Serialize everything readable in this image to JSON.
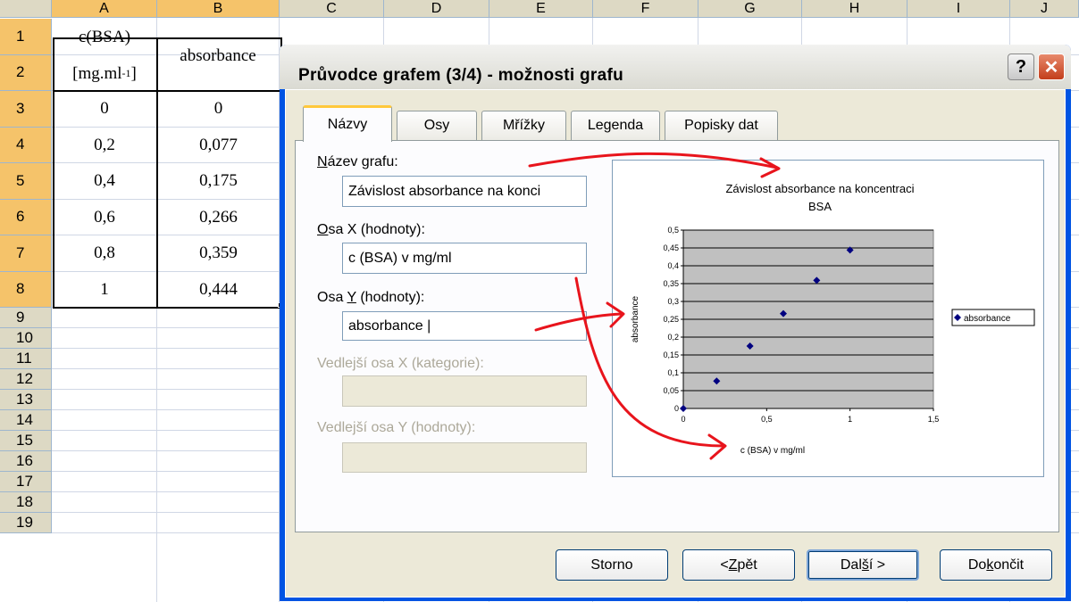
{
  "sheet": {
    "columns": [
      "A",
      "B",
      "C",
      "D",
      "E",
      "F",
      "G",
      "H",
      "I",
      "J"
    ],
    "rows": [
      "1",
      "2",
      "3",
      "4",
      "5",
      "6",
      "7",
      "8",
      "9",
      "10",
      "11",
      "12",
      "13",
      "14",
      "15",
      "16",
      "17",
      "18",
      "19"
    ],
    "header_a1": "c(BSA)",
    "header_a2_pre": "[mg.ml",
    "header_a2_sup": "-1",
    "header_a2_post": "]",
    "header_b2": "absorbance",
    "data_a": [
      "0",
      "0,2",
      "0,4",
      "0,6",
      "0,8",
      "1"
    ],
    "data_b": [
      "0",
      "0,077",
      "0,175",
      "0,266",
      "0,359",
      "0,444"
    ]
  },
  "dialog": {
    "title": "Průvodce grafem (3/4) - možnosti grafu",
    "help_label": "?",
    "close_label": "✕",
    "tabs": [
      "Názvy",
      "Osy",
      "Mřížky",
      "Legenda",
      "Popisky dat"
    ],
    "fields": {
      "chart_title_label": "Název grafu:",
      "chart_title_value": "Závislost absorbance na konci",
      "x_label": "Osa X (hodnoty):",
      "x_value": "c (BSA) v mg/ml",
      "y_label": "Osa Y (hodnoty):",
      "y_value": "absorbance |",
      "x2_label": "Vedlejší osa X (kategorie):",
      "y2_label": "Vedlejší osa Y (hodnoty):"
    },
    "buttons": {
      "cancel": "Storno",
      "back": "< Zpět",
      "next": "Další >",
      "finish": "Dokončit"
    }
  },
  "chart_data": {
    "type": "scatter",
    "title_line1": "Závislost absorbance na koncentraci",
    "title_line2": "BSA",
    "xlabel": "c (BSA) v mg/ml",
    "ylabel": "absorbance",
    "x_ticks": [
      "0",
      "0,5",
      "1",
      "1,5"
    ],
    "y_ticks": [
      "0",
      "0,05",
      "0,1",
      "0,15",
      "0,2",
      "0,25",
      "0,3",
      "0,35",
      "0,4",
      "0,45",
      "0,5"
    ],
    "xlim": [
      0,
      1.5
    ],
    "ylim": [
      0,
      0.5
    ],
    "series": [
      {
        "name": "absorbance",
        "x": [
          0,
          0.2,
          0.4,
          0.6,
          0.8,
          1
        ],
        "y": [
          0,
          0.077,
          0.175,
          0.266,
          0.359,
          0.444
        ]
      }
    ],
    "legend_position": "right",
    "plot_area_color": "#c0c0c0",
    "marker_color": "#000080",
    "grid": true
  },
  "colors": {
    "selected_header": "#f5c36a",
    "header": "#ddd9c4",
    "annotation_arrows": "#e8141c",
    "dialog_frame": "#0054e3"
  }
}
